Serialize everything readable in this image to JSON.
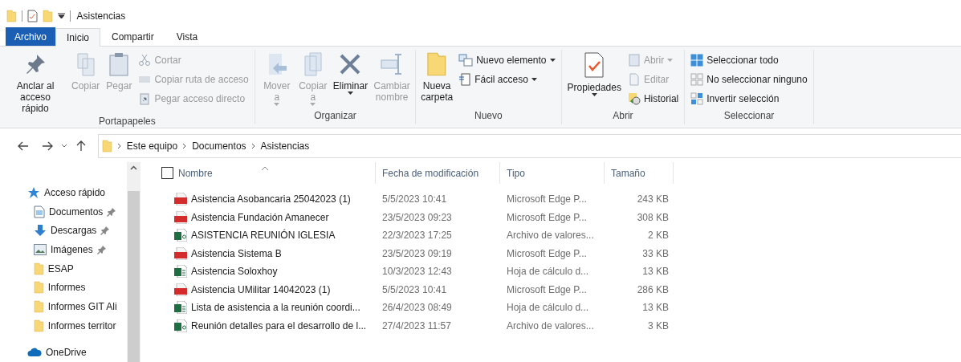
{
  "window": {
    "title": "Asistencias"
  },
  "ribbon_tabs": [
    {
      "label": "Archivo",
      "kind": "file",
      "selected": false
    },
    {
      "label": "Inicio",
      "kind": "tab",
      "selected": true
    },
    {
      "label": "Compartir",
      "kind": "tab",
      "selected": false
    },
    {
      "label": "Vista",
      "kind": "tab",
      "selected": false
    }
  ],
  "ribbon_groups": [
    {
      "label": "Portapapeles",
      "items": [
        {
          "kind": "large",
          "label": "Anclar al acceso rápido",
          "disabled": false,
          "dropdown": false
        },
        {
          "kind": "large",
          "label": "Copiar",
          "disabled": true,
          "dropdown": false
        },
        {
          "kind": "large",
          "label": "Pegar",
          "disabled": true,
          "dropdown": false
        },
        {
          "kind": "small",
          "label": "Cortar",
          "disabled": true,
          "dropdown": false
        },
        {
          "kind": "small",
          "label": "Copiar ruta de acceso",
          "disabled": true,
          "dropdown": false
        },
        {
          "kind": "small",
          "label": "Pegar acceso directo",
          "disabled": true,
          "dropdown": false
        }
      ]
    },
    {
      "label": "Organizar",
      "items": [
        {
          "kind": "large",
          "label": "Mover a",
          "disabled": true,
          "dropdown": true
        },
        {
          "kind": "large",
          "label": "Copiar a",
          "disabled": true,
          "dropdown": true
        },
        {
          "kind": "large",
          "label": "Eliminar",
          "disabled": false,
          "dropdown": true
        },
        {
          "kind": "large",
          "label": "Cambiar nombre",
          "disabled": true,
          "dropdown": false
        }
      ]
    },
    {
      "label": "Nuevo",
      "items": [
        {
          "kind": "large",
          "label": "Nueva carpeta",
          "disabled": false,
          "dropdown": false
        },
        {
          "kind": "small",
          "label": "Nuevo elemento",
          "disabled": false,
          "dropdown": true
        },
        {
          "kind": "small",
          "label": "Fácil acceso",
          "disabled": false,
          "dropdown": true
        }
      ]
    },
    {
      "label": "Abrir",
      "items": [
        {
          "kind": "large",
          "label": "Propiedades",
          "disabled": false,
          "dropdown": true
        },
        {
          "kind": "small",
          "label": "Abrir",
          "disabled": true,
          "dropdown": true
        },
        {
          "kind": "small",
          "label": "Editar",
          "disabled": true,
          "dropdown": false
        },
        {
          "kind": "small",
          "label": "Historial",
          "disabled": false,
          "dropdown": false
        }
      ]
    },
    {
      "label": "Seleccionar",
      "items": [
        {
          "kind": "small",
          "label": "Seleccionar todo",
          "disabled": false,
          "dropdown": false
        },
        {
          "kind": "small",
          "label": "No seleccionar ninguno",
          "disabled": false,
          "dropdown": false
        },
        {
          "kind": "small",
          "label": "Invertir selección",
          "disabled": false,
          "dropdown": false
        }
      ]
    }
  ],
  "address_bar": {
    "path": [
      "Este equipo",
      "Documentos",
      "Asistencias"
    ]
  },
  "sidebar": {
    "items": [
      {
        "label": "Acceso rápido",
        "kind": "quick",
        "pinned": false
      },
      {
        "label": "Documentos",
        "kind": "documents",
        "pinned": true
      },
      {
        "label": "Descargas",
        "kind": "downloads",
        "pinned": true
      },
      {
        "label": "Imágenes",
        "kind": "images",
        "pinned": true
      },
      {
        "label": "ESAP",
        "kind": "folder",
        "pinned": false
      },
      {
        "label": "Informes",
        "kind": "folder",
        "pinned": false
      },
      {
        "label": "Informes GIT Ali",
        "kind": "folder",
        "pinned": false
      },
      {
        "label": "Informes territor",
        "kind": "folder",
        "pinned": false
      },
      {
        "label": "OneDrive",
        "kind": "cloud",
        "pinned": false
      }
    ]
  },
  "table": {
    "select_all": {
      "checked": false
    },
    "columns": [
      {
        "label": "Nombre",
        "sorted": true
      },
      {
        "label": "Fecha de modificación",
        "sorted": false
      },
      {
        "label": "Tipo",
        "sorted": false
      },
      {
        "label": "Tamaño",
        "sorted": false
      }
    ],
    "rows": [
      {
        "kind": "pdf",
        "name": "Asistencia Asobancaria 25042023 (1)",
        "date": "5/5/2023 10:41",
        "type": "Microsoft Edge P...",
        "size": "243 KB"
      },
      {
        "kind": "pdf",
        "name": "Asistencia Fundación Amanecer",
        "date": "23/5/2023 09:23",
        "type": "Microsoft Edge P...",
        "size": "308 KB"
      },
      {
        "kind": "csv",
        "name": "ASISTENCIA REUNIÓN IGLESIA",
        "date": "22/3/2023 17:25",
        "type": "Archivo de valores...",
        "size": "2 KB"
      },
      {
        "kind": "pdf",
        "name": "Asistencia Sistema B",
        "date": "23/5/2023 09:19",
        "type": "Microsoft Edge P...",
        "size": "33 KB"
      },
      {
        "kind": "xlsx",
        "name": "Asistencia Soloxhoy",
        "date": "10/3/2023 12:43",
        "type": "Hoja de cálculo d...",
        "size": "13 KB"
      },
      {
        "kind": "pdf",
        "name": "Asistencia UMilitar 14042023 (1)",
        "date": "5/5/2023 10:41",
        "type": "Microsoft Edge P...",
        "size": "286 KB"
      },
      {
        "kind": "xlsx",
        "name": "Lista de asistencia a la reunión coordi...",
        "date": "26/4/2023 08:49",
        "type": "Hoja de cálculo d...",
        "size": "13 KB"
      },
      {
        "kind": "csv",
        "name": "Reunión detalles para el desarrollo de l...",
        "date": "27/4/2023 11:57",
        "type": "Archivo de valores...",
        "size": "3 KB"
      }
    ]
  }
}
